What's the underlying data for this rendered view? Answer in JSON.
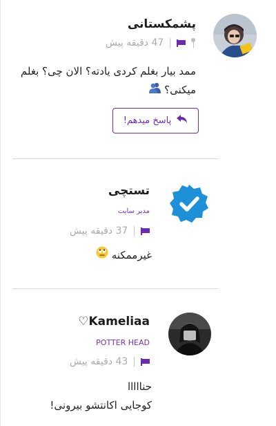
{
  "comments": [
    {
      "author": "پشمکستانی",
      "time": "47 دقیقه پیش",
      "text_line1": "ممد بیار بغلم کردی یادته؟ الان چی؟ بغلم",
      "text_line2": "میکنی؟",
      "reply_label": "پاسخ میدهم!",
      "icons": {
        "pin": "pin-icon",
        "flag": "flag-icon",
        "emoji": "busts-in-silhouette-emoji",
        "reply": "reply-arrow-icon"
      }
    },
    {
      "author": "تستچی",
      "role": "مدیر سایت",
      "time": "37 دقیقه پیش",
      "text": "غیرممکنه",
      "icons": {
        "avatar": "verified-badge-icon",
        "flag": "flag-icon",
        "emoji": "face-with-rolling-eyes-emoji"
      }
    },
    {
      "author": "♡Kameliaa",
      "role": "POTTER HEAD",
      "time": "43 دقیقه پیش",
      "text_line1": "حنااااا",
      "text_line2": "کوجایی اکانتشو بیرونی!",
      "icons": {
        "flag": "flag-icon"
      }
    }
  ],
  "colors": {
    "accent": "#6a2bb0",
    "verified": "#1e90d8",
    "muted": "#aaaaaa",
    "divider": "#d9d9d9"
  }
}
